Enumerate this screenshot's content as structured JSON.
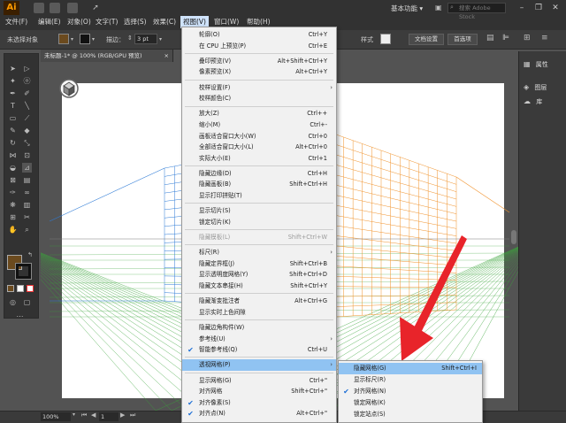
{
  "app": {
    "logo": "Ai",
    "workspace": "基本功能 ▾",
    "search_placeholder": "搜索 Adobe Stock",
    "window_controls": [
      "–",
      "❐",
      "✕"
    ]
  },
  "menubar": {
    "items": [
      "文件(F)",
      "编辑(E)",
      "对象(O)",
      "文字(T)",
      "选择(S)",
      "效果(C)",
      "视图(V)",
      "窗口(W)",
      "帮助(H)"
    ],
    "active_index": 6
  },
  "controlbar": {
    "selection_label": "未选择对象",
    "stroke_label": "描边：",
    "stroke_value": "3 pt",
    "style_label": "样式",
    "doc_settings": "文档设置",
    "preferences": "首选项"
  },
  "document": {
    "tab_title": "未标题-1* @ 100% (RGB/GPU 预览)",
    "close": "×"
  },
  "right_panel": {
    "items": [
      {
        "label": "属性",
        "icon": "properties-icon"
      },
      {
        "label": "图层",
        "icon": "layers-icon"
      },
      {
        "label": "库",
        "icon": "libraries-icon"
      }
    ]
  },
  "statusbar": {
    "zoom": "100%",
    "page": "1"
  },
  "view_menu": {
    "items": [
      {
        "label": "轮廓(O)",
        "shortcut": "Ctrl+Y"
      },
      {
        "label": "在 CPU 上预览(P)",
        "shortcut": "Ctrl+E"
      },
      {
        "sep": true
      },
      {
        "label": "叠印预览(V)",
        "shortcut": "Alt+Shift+Ctrl+Y"
      },
      {
        "label": "像素预览(X)",
        "shortcut": "Alt+Ctrl+Y"
      },
      {
        "sep": true
      },
      {
        "label": "校样设置(F)",
        "submenu": true
      },
      {
        "label": "校样颜色(C)"
      },
      {
        "sep": true
      },
      {
        "label": "放大(Z)",
        "shortcut": "Ctrl++"
      },
      {
        "label": "缩小(M)",
        "shortcut": "Ctrl+-"
      },
      {
        "label": "画板适合窗口大小(W)",
        "shortcut": "Ctrl+0"
      },
      {
        "label": "全部适合窗口大小(L)",
        "shortcut": "Alt+Ctrl+0"
      },
      {
        "label": "实际大小(E)",
        "shortcut": "Ctrl+1"
      },
      {
        "sep": true
      },
      {
        "label": "隐藏边缘(D)",
        "shortcut": "Ctrl+H"
      },
      {
        "label": "隐藏画板(B)",
        "shortcut": "Shift+Ctrl+H"
      },
      {
        "label": "显示打印拼贴(T)"
      },
      {
        "sep": true
      },
      {
        "label": "显示切片(S)"
      },
      {
        "label": "锁定切片(K)"
      },
      {
        "sep": true
      },
      {
        "label": "隐藏模板(L)",
        "shortcut": "Shift+Ctrl+W",
        "disabled": true
      },
      {
        "sep": true
      },
      {
        "label": "标尺(R)",
        "submenu": true
      },
      {
        "label": "隐藏定界框(J)",
        "shortcut": "Shift+Ctrl+B"
      },
      {
        "label": "显示透明度网格(Y)",
        "shortcut": "Shift+Ctrl+D"
      },
      {
        "label": "隐藏文本串接(H)",
        "shortcut": "Shift+Ctrl+Y"
      },
      {
        "sep": true
      },
      {
        "label": "隐藏渐变批注者",
        "shortcut": "Alt+Ctrl+G"
      },
      {
        "label": "显示实时上色间隙"
      },
      {
        "sep": true
      },
      {
        "label": "隐藏边角构件(W)"
      },
      {
        "label": "参考线(U)",
        "submenu": true
      },
      {
        "label": "智能参考线(Q)",
        "shortcut": "Ctrl+U",
        "checked": true
      },
      {
        "sep": true
      },
      {
        "label": "透视网格(P)",
        "submenu": true,
        "highlighted": true
      },
      {
        "sep": true
      },
      {
        "label": "显示网格(G)",
        "shortcut": "Ctrl+\""
      },
      {
        "label": "对齐网格",
        "shortcut": "Shift+Ctrl+\""
      },
      {
        "label": "对齐像素(S)",
        "checked": true
      },
      {
        "label": "对齐点(N)",
        "shortcut": "Alt+Ctrl+\"",
        "checked": true
      }
    ]
  },
  "perspective_submenu": {
    "items": [
      {
        "label": "隐藏网格(G)",
        "shortcut": "Shift+Ctrl+I",
        "highlighted": true
      },
      {
        "label": "显示标尺(R)"
      },
      {
        "label": "对齐网格(N)",
        "checked": true
      },
      {
        "label": "锁定网格(K)"
      },
      {
        "label": "锁定站点(S)"
      }
    ]
  },
  "colors": {
    "fill_swatch": "#6b4a1e",
    "arrow": "#e8242a",
    "grid_left": "#2e7bd6",
    "grid_right": "#f0922b",
    "grid_floor": "#3aa53a",
    "menu_highlight": "#90c3f2"
  }
}
